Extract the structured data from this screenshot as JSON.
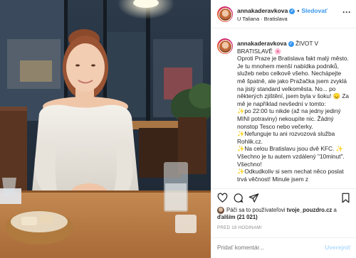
{
  "header": {
    "username": "annakaderavkova",
    "follow_label": "Sledovať",
    "location": "U Taliana · Bratislava",
    "more_icon": "more-horizontal-icon"
  },
  "caption": {
    "username": "annakaderavkova",
    "title": "ŽIVOT V BRATISLAVĚ",
    "lines": [
      "Oproti Praze je Bratislava fakt malý město. Je tu mnohem menší nabídka podniků, služeb nebo celkově všeho. Nechápejte mě špatně, ale jako Pražačka jsem zvyklá na jistý standard velkoměsta. No... po některých zjištění, jsem byla v šoku!",
      "Za mě je například nevšední v tomto:",
      "po 22:00 tu nikde (až na jedny jediný MINI potraviny) nekoupíte nic. Žádný nonstop Tesco nebo večerky.",
      "Nefunguje tu ani rozvozová služba Rohlik.cz.",
      "Na celou Bratislavu jsou dvě KFC.",
      "Všechno je tu autem vzdálený \"10minut\". Všechno!",
      "Odkudkoliv si sem nechat něco poslat trvá věčnost! Minule jsem z"
    ]
  },
  "actions": {
    "like_icon": "heart-icon",
    "comment_icon": "comment-icon",
    "share_icon": "share-icon",
    "save_icon": "bookmark-icon"
  },
  "likes": {
    "prefix": "Páči sa to používateľovi",
    "user": "tvoje_pouzdro.cz",
    "connector": "a",
    "others": "ďalším (21 021)"
  },
  "timestamp": "PRED 18 HODINAMI",
  "comment_box": {
    "placeholder": "Pridať komentár...",
    "post_label": "Uverejniť"
  },
  "colors": {
    "link_blue": "#3897f0",
    "muted_gray": "#8e8e8e",
    "post_disabled": "#b3dbff"
  }
}
